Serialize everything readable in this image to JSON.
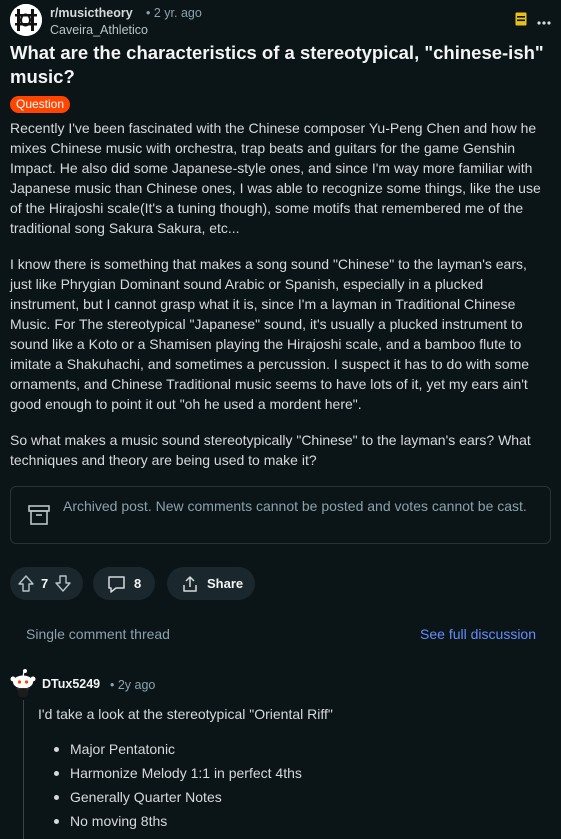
{
  "post": {
    "subreddit": "r/musictheory",
    "time": "• 2 yr. ago",
    "author": "Caveira_Athletico",
    "title": "What are the characteristics of a stereotypical, \"chinese-ish\" music?",
    "flair": "Question",
    "paragraphs": [
      "Recently I've been fascinated with the Chinese composer Yu-Peng Chen and how he mixes Chinese music with orchestra, trap beats and guitars for the game Genshin Impact. He also did some Japanese-style ones, and since I'm way more familiar with Japanese music than Chinese ones, I was able to recognize some things, like the use of the Hirajoshi scale(It's a tuning though), some motifs that remembered me of the traditional song Sakura Sakura, etc...",
      "I know there is something that makes a song sound \"Chinese\" to the layman's ears, just like Phrygian Dominant sound Arabic or Spanish, especially in a plucked instrument, but I cannot grasp what it is, since I'm a layman in Traditional Chinese Music. For The stereotypical \"Japanese\" sound, it's usually a plucked instrument to sound like a Koto or a Shamisen playing the Hirajoshi scale, and a bamboo flute to imitate a Shakuhachi, and sometimes a percussion. I suspect it has to do with some ornaments, and Chinese Traditional music seems to have lots of it, yet my ears ain't good enough to point it out \"oh he used a mordent here\".",
      "So what makes a music sound stereotypically \"Chinese\" to the layman's ears? What techniques and theory are being used to make it?"
    ],
    "archived_notice": "Archived post. New comments cannot be posted and votes cannot be cast.",
    "votes": "7",
    "comments": "8",
    "share_label": "Share"
  },
  "thread": {
    "label": "Single comment thread",
    "full_link": "See full discussion"
  },
  "comment": {
    "author": "DTux5249",
    "time": "• 2y ago",
    "text": "I'd take a look at the stereotypical \"Oriental Riff\"",
    "bullets": [
      "Major Pentatonic",
      "Harmonize Melody 1:1 in perfect 4ths",
      "Generally Quarter Notes",
      "No moving 8ths"
    ]
  },
  "colors": {
    "background": "#0b1416",
    "flair": "#ff4500",
    "link": "#648efc",
    "save_icon": "#e8c21a"
  },
  "icons": [
    "subreddit-avatar-icon",
    "save-icon",
    "more-icon",
    "archive-box-icon",
    "upvote-icon",
    "downvote-icon",
    "comment-icon",
    "share-icon",
    "snoo-avatar-icon"
  ]
}
